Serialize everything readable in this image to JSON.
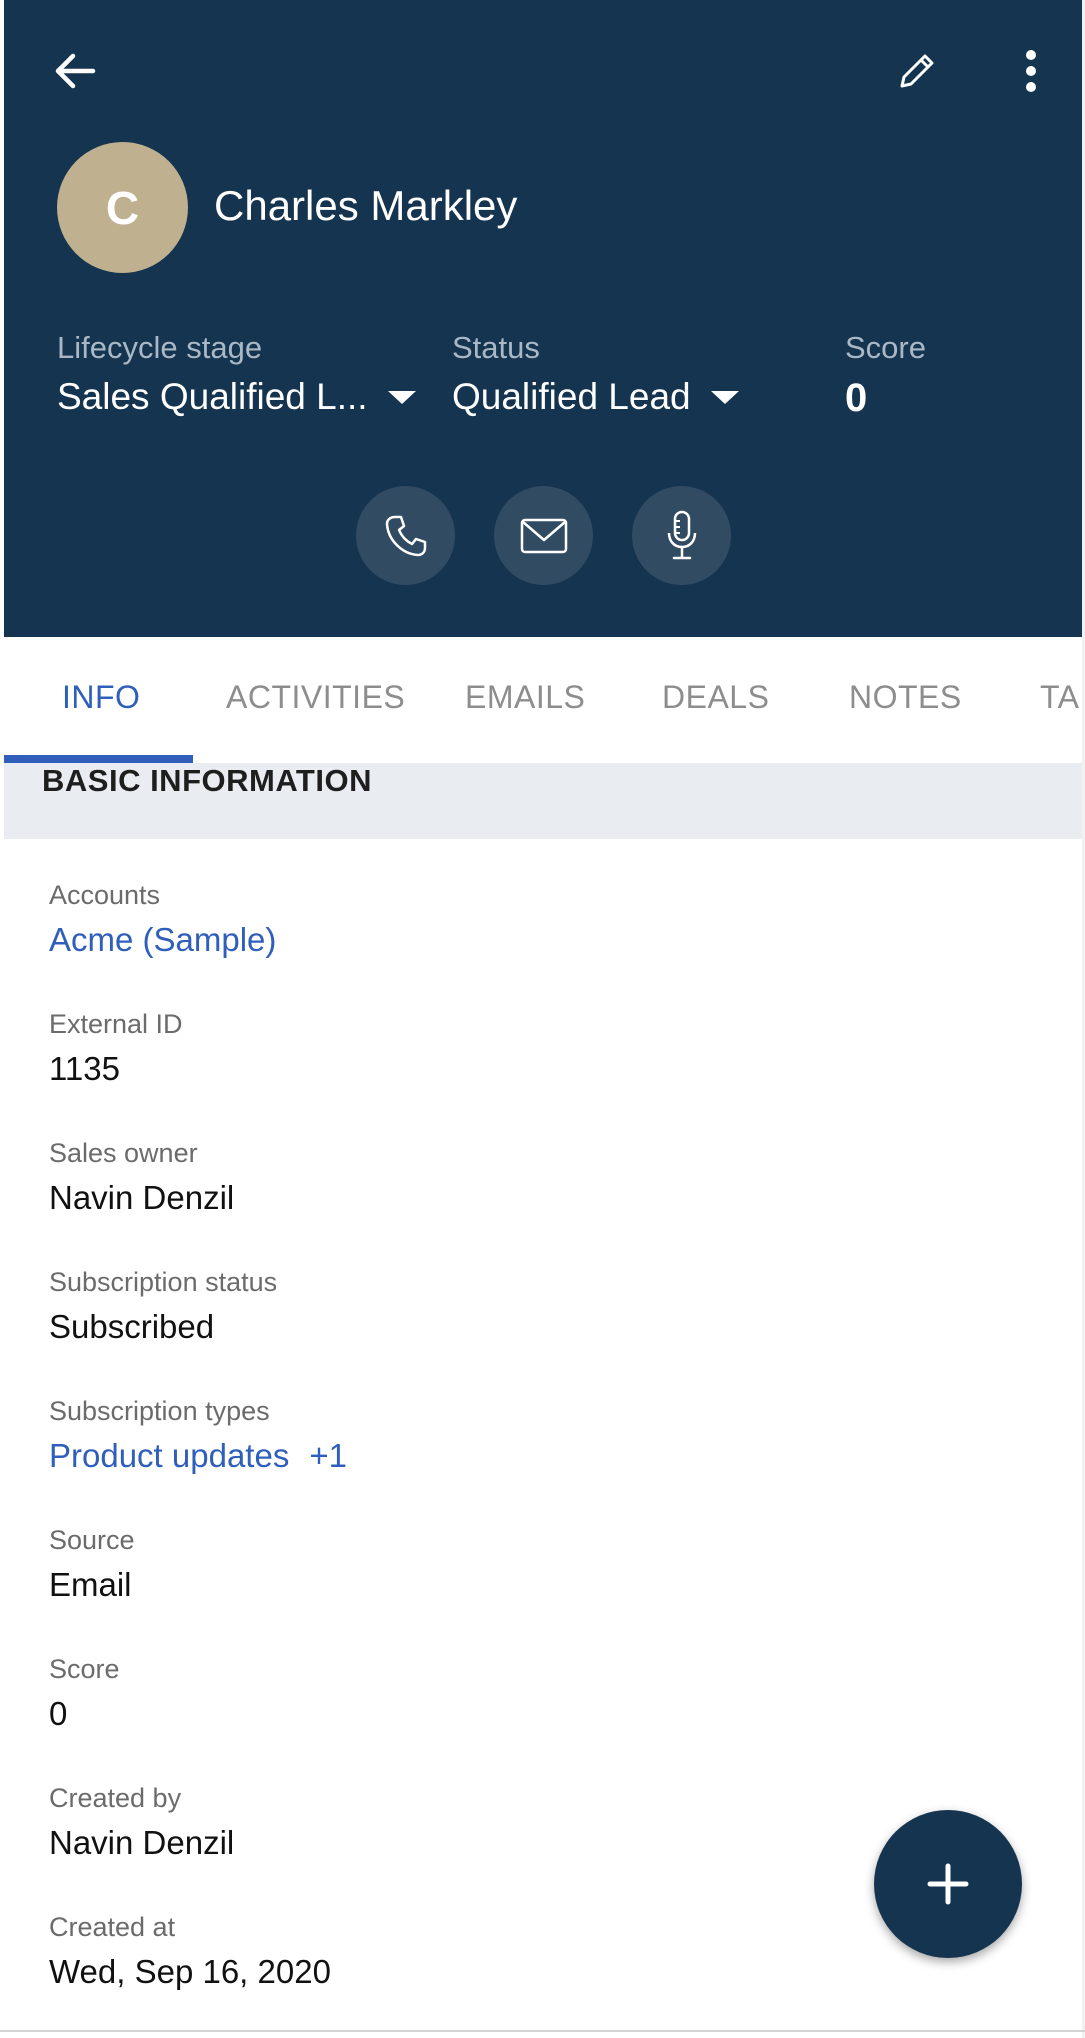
{
  "header": {
    "back_icon": "arrow-left-icon",
    "edit_icon": "pencil-icon",
    "more_icon": "more-vertical-icon",
    "avatar_initial": "C",
    "avatar_color": "#bfb08f",
    "contact_name": "Charles Markley",
    "background_color": "#15344f"
  },
  "stats": {
    "lifecycle_label": "Lifecycle stage",
    "lifecycle_value": "Sales Qualified L...",
    "status_label": "Status",
    "status_value": "Qualified Lead",
    "score_label": "Score",
    "score_value": "0"
  },
  "actions": {
    "call_icon": "phone-icon",
    "email_icon": "mail-icon",
    "voice_icon": "microphone-icon"
  },
  "tabs": [
    {
      "label": "INFO",
      "active": true
    },
    {
      "label": "ACTIVITIES",
      "active": false
    },
    {
      "label": "EMAILS",
      "active": false
    },
    {
      "label": "DEALS",
      "active": false
    },
    {
      "label": "NOTES",
      "active": false
    },
    {
      "label": "TA",
      "active": false
    }
  ],
  "section": {
    "title": "BASIC INFORMATION"
  },
  "fields": {
    "accounts": {
      "label": "Accounts",
      "value": "Acme (Sample)"
    },
    "external_id": {
      "label": "External ID",
      "value": "1135"
    },
    "sales_owner": {
      "label": "Sales owner",
      "value": "Navin Denzil"
    },
    "subscription_status": {
      "label": "Subscription status",
      "value": "Subscribed"
    },
    "subscription_types": {
      "label": "Subscription types",
      "value": "Product updates",
      "extra": "+1"
    },
    "source": {
      "label": "Source",
      "value": "Email"
    },
    "score": {
      "label": "Score",
      "value": "0"
    },
    "created_by": {
      "label": "Created by",
      "value": "Navin Denzil"
    },
    "created_at": {
      "label": "Created at",
      "value": "Wed, Sep 16, 2020"
    }
  },
  "fab": {
    "icon": "plus-icon"
  },
  "colors": {
    "accent": "#2f5fbb",
    "header": "#15344f"
  }
}
